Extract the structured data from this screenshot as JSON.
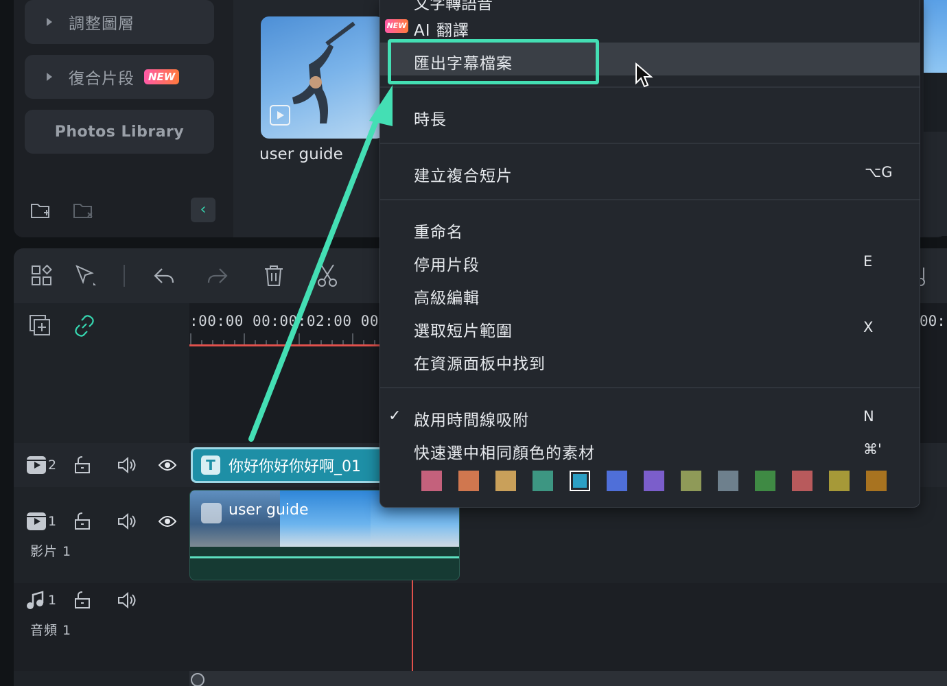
{
  "sidebar": {
    "items": [
      {
        "label": "調整圖層",
        "has_arrow": true,
        "badge": ""
      },
      {
        "label": "復合片段",
        "has_arrow": true,
        "badge": "NEW"
      },
      {
        "label": "Photos Library",
        "has_arrow": false,
        "badge": ""
      }
    ]
  },
  "media": {
    "thumbnail_label": "user guide"
  },
  "timeline": {
    "ruler_text": ":00:00  00:00:02:00  00:",
    "ruler_right": "00:",
    "tracks": {
      "text_track_num": "2",
      "video_track_num": "1",
      "video_track_name": "影片 1",
      "audio_track_num": "1",
      "audio_track_name": "音頻 1"
    },
    "text_clip_label": "你好你好你好啊_01",
    "text_clip_icon": "T",
    "video_clip_label": "user guide"
  },
  "context_menu": {
    "partial_top_item": "文字轉語音",
    "new_badge": "NEW",
    "items": {
      "ai_translate": "AI 翻譯",
      "export_subtitles": "匯出字幕檔案",
      "duration": "時長",
      "create_compound": "建立複合短片",
      "create_compound_shortcut": "⌥G",
      "rename": "重命名",
      "disable_clip": "停用片段",
      "disable_clip_shortcut": "E",
      "advanced_edit": "高級編輯",
      "select_range": "選取短片範圍",
      "select_range_shortcut": "X",
      "find_in_media": "在資源面板中找到",
      "enable_snapping": "啟用時間線吸附",
      "enable_snapping_shortcut": "N",
      "select_same_color": "快速選中相同顏色的素材",
      "select_same_color_shortcut": "⌘'"
    },
    "check_mark": "✓",
    "color_swatches": [
      "#c4617c",
      "#d0774f",
      "#c9a05a",
      "#3d9682",
      "#2b9fc4",
      "#4f6fd9",
      "#7b5ecb",
      "#8f9a58",
      "#6e808d",
      "#3f8a44",
      "#b85a5c",
      "#a69938",
      "#a87320"
    ],
    "selected_swatch_index": 4
  },
  "colors": {
    "accent": "#44dfb4",
    "playhead": "#e0514c",
    "text_clip": "#1e8fa6"
  },
  "icons": {
    "cursor": "arrow-pointer-icon",
    "annotation_arrow": "teal-arrow-icon"
  }
}
